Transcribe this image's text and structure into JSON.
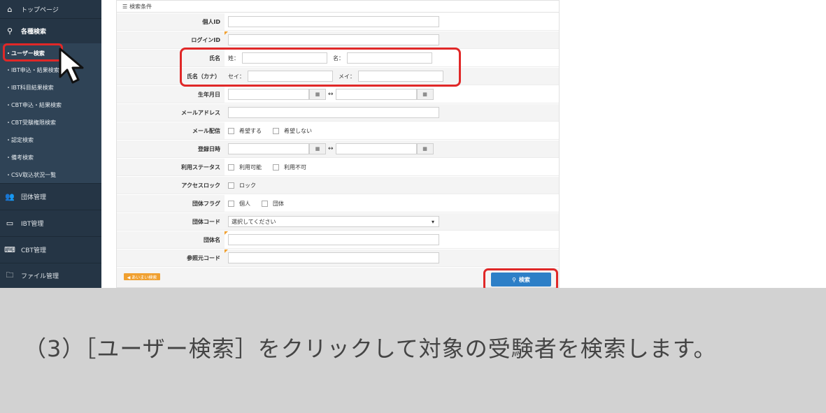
{
  "sidebar": {
    "top": {
      "label": "トップページ",
      "icon": "home-icon"
    },
    "search": {
      "label": "各種検索",
      "icon": "search-icon"
    },
    "sub_items": [
      {
        "label": "・ユーザー検索"
      },
      {
        "label": "・IBT申込・結果検索"
      },
      {
        "label": "・IBT科目結果検索"
      },
      {
        "label": "・CBT申込・結果検索"
      },
      {
        "label": "・CBT受験権限検索"
      },
      {
        "label": "・認定検索"
      },
      {
        "label": "・備考検索"
      },
      {
        "label": "・CSV取込状況一覧"
      }
    ],
    "groups": [
      {
        "label": "団体管理",
        "icon": "users-icon"
      },
      {
        "label": "IBT管理",
        "icon": "monitor-icon"
      },
      {
        "label": "CBT管理",
        "icon": "keyboard-icon"
      },
      {
        "label": "ファイル管理",
        "icon": "folder-icon"
      }
    ]
  },
  "form": {
    "title": "検索条件",
    "fields": {
      "personal_id": "個人ID",
      "login_id": "ログインID",
      "name": "氏名",
      "name_last": "姓：",
      "name_first": "名：",
      "kana": "氏名（カナ）",
      "kana_last": "セイ：",
      "kana_first": "メイ：",
      "birth": "生年月日",
      "email": "メールアドレス",
      "mail_delivery": "メール配信",
      "mail_yes": "希望する",
      "mail_no": "希望しない",
      "register": "登録日時",
      "status": "利用ステータス",
      "status_ok": "利用可能",
      "status_ng": "利用不可",
      "lock": "アクセスロック",
      "lock_opt": "ロック",
      "group_flag": "団体フラグ",
      "flag_personal": "個人",
      "flag_group": "団体",
      "group_code": "団体コード",
      "group_code_value": "選択してください",
      "group_name": "団体名",
      "ref_code": "参照元コード"
    },
    "clear_label": "◀ あいまい検索",
    "search_label": "検索"
  },
  "caption": "（3）［ユーザー検索］をクリックして対象の受験者を検索します。"
}
